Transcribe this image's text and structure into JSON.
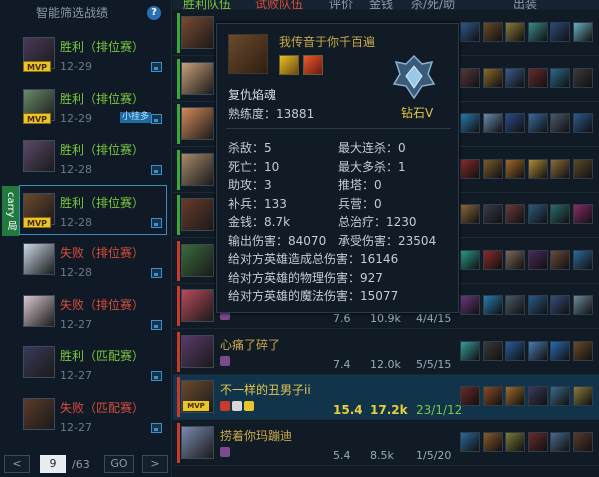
{
  "left": {
    "title": "智能筛选战绩",
    "help": "?",
    "carry_label": "carry 局",
    "matches": [
      {
        "result": "胜利",
        "type": "（排位赛）",
        "date": "12-29",
        "win": true,
        "mvp": "MVP",
        "tag": ""
      },
      {
        "result": "胜利",
        "type": "（排位赛）",
        "date": "12-29",
        "win": true,
        "mvp": "MVP",
        "tag": "小挂多"
      },
      {
        "result": "胜利",
        "type": "（排位赛）",
        "date": "12-28",
        "win": true,
        "mvp": "",
        "tag": ""
      },
      {
        "result": "胜利",
        "type": "（排位赛）",
        "date": "12-28",
        "win": true,
        "mvp": "MVP",
        "tag": ""
      },
      {
        "result": "失败",
        "type": "（排位赛）",
        "date": "12-28",
        "win": false,
        "mvp": "",
        "tag": ""
      },
      {
        "result": "失败",
        "type": "（排位赛）",
        "date": "12-27",
        "win": false,
        "mvp": "",
        "tag": ""
      },
      {
        "result": "胜利",
        "type": "（匹配赛）",
        "date": "12-27",
        "win": true,
        "mvp": "",
        "tag": ""
      },
      {
        "result": "失败",
        "type": "（匹配赛）",
        "date": "12-27",
        "win": false,
        "mvp": "",
        "tag": ""
      }
    ],
    "pager": {
      "prev": "<",
      "page": "9",
      "total": "/63",
      "go": "GO",
      "next": ">"
    }
  },
  "table": {
    "headers": [
      "胜利队伍",
      "试败队伍",
      "评价",
      "金钱",
      "杀/死/助",
      "出装"
    ],
    "rows": [
      {
        "name": "",
        "score": "",
        "gold": "",
        "kda": "",
        "win": true,
        "mine": false,
        "mvp": "",
        "avatar_color": "#7a4a2e"
      },
      {
        "name": "",
        "score": "",
        "gold": "",
        "kda": "",
        "win": true,
        "mine": false,
        "mvp": "",
        "avatar_color": "#c9a07a"
      },
      {
        "name": "",
        "score": "",
        "gold": "",
        "kda": "",
        "win": true,
        "mine": false,
        "mvp": "",
        "avatar_color": "#d48a5a"
      },
      {
        "name": "",
        "score": "",
        "gold": "",
        "kda": "",
        "win": true,
        "mine": false,
        "mvp": "",
        "avatar_color": "#a88a6a"
      },
      {
        "name": "",
        "score": "",
        "gold": "",
        "kda": "",
        "win": true,
        "mine": false,
        "mvp": "",
        "avatar_color": "#6a3a2a"
      },
      {
        "name": "",
        "score": "",
        "gold": "",
        "kda": "",
        "win": false,
        "mine": false,
        "mvp": "",
        "avatar_color": "#3a6a3a"
      },
      {
        "name": "",
        "score": "7.6",
        "gold": "10.9k",
        "kda": "4/4/15",
        "win": false,
        "mine": false,
        "mvp": "",
        "avatar_color": "#b84a5a"
      },
      {
        "name": "心痛了碎了",
        "score": "7.4",
        "gold": "12.0k",
        "kda": "5/5/15",
        "win": false,
        "mine": false,
        "mvp": "",
        "avatar_color": "#5a3a6a"
      },
      {
        "name": "不一样的丑男子ii",
        "score": "15.4",
        "gold": "17.2k",
        "kda": "23/1/12",
        "win": false,
        "mine": true,
        "mvp": "MVP",
        "avatar_color": "#6b4a2c"
      },
      {
        "name": "捞着你玛蹦迪",
        "score": "5.4",
        "gold": "8.5k",
        "kda": "1/5/20",
        "win": false,
        "mine": false,
        "mvp": "",
        "avatar_color": "#7a8ab0"
      }
    ],
    "item_colors": [
      [
        "#2f5a8a",
        "#6a4a2a",
        "#8a7a3a",
        "#3a8a8a",
        "#2a4a7a",
        "#6ab0c0"
      ],
      [
        "#5a3a3a",
        "#8a6a2a",
        "#3a5a8a",
        "#6a2a2a",
        "#2a6a8a",
        "#3a3a3a"
      ],
      [
        "#2a7ab0",
        "#6a8ab0",
        "#2a4a8a",
        "#3a6a9a",
        "#4a5a6a",
        "#2a5a8a"
      ],
      [
        "#8a2a2a",
        "#7a5a2a",
        "#a06a2a",
        "#b08a3a",
        "#8a6a3a",
        "#5a4a2a"
      ],
      [
        "#8a6a3a",
        "#3a3a4a",
        "#6a3a3a",
        "#2a5a7a",
        "#2a6a6a",
        "#8a2a6a"
      ],
      [
        "#2a9a8a",
        "#8a2a2a",
        "#7a6a5a",
        "#4a2a5a",
        "#6a4a3a",
        "#2a6a9a"
      ],
      [
        "#6a3a7a",
        "#2a7ab0",
        "#4a5a6a",
        "#2a5a8a",
        "#3a4a7a",
        "#6a8a9a"
      ],
      [
        "#3a9a9a",
        "#3a3a3a",
        "#2a5a9a",
        "#4a7ab0",
        "#2a6ab0",
        "#6a4a2a"
      ],
      [
        "#6a2a2a",
        "#8a4a2a",
        "#a06a2a",
        "#3a3a5a",
        "#3a6a8a",
        "#8a7a3a"
      ],
      [
        "#2a6a9a",
        "#8a5a2a",
        "#7a7a3a",
        "#6a2a2a",
        "#4a6a8a",
        "#5a3a2a"
      ]
    ]
  },
  "tooltip": {
    "subtitle": "我传音于你千百遍",
    "champion": "复仇焰魂",
    "proficiency_label": "熟练度",
    "proficiency": "13881",
    "tier": "钻石Ⅴ",
    "stats": [
      {
        "label": "杀敌",
        "value": "5"
      },
      {
        "label": "最大连杀",
        "value": "0"
      },
      {
        "label": "死亡",
        "value": "10"
      },
      {
        "label": "最大多杀",
        "value": "1"
      },
      {
        "label": "助攻",
        "value": "3"
      },
      {
        "label": "推塔",
        "value": "0"
      },
      {
        "label": "补兵",
        "value": "133"
      },
      {
        "label": "兵营",
        "value": "0"
      },
      {
        "label": "金钱",
        "value": "8.7k"
      },
      {
        "label": "总治疗",
        "value": "1230"
      },
      {
        "label": "输出伤害",
        "value": "84070"
      },
      {
        "label": "承受伤害",
        "value": "23504"
      }
    ],
    "long_stats": [
      {
        "label": "给对方英雄造成总伤害",
        "value": "16146"
      },
      {
        "label": "给对方英雄的物理伤害",
        "value": "927"
      },
      {
        "label": "给对方英雄的魔法伤害",
        "value": "15077"
      }
    ]
  }
}
